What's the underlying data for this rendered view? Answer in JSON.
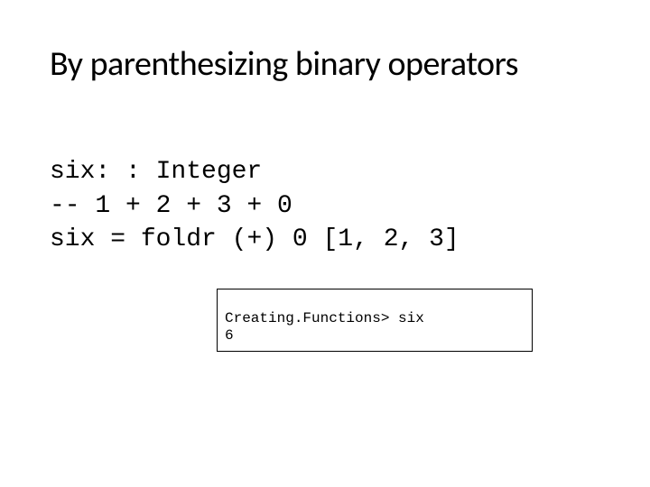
{
  "title": "By parenthesizing binary operators",
  "code": {
    "line1": "six: : Integer",
    "line2": "-- 1 + 2 + 3 + 0",
    "line3_prefix": "six = foldr ",
    "line3_op": "(+)",
    "line3_mid": " 0 ",
    "line3_list": "[1, 2, 3]"
  },
  "terminal": {
    "prompt_line": "Creating.Functions> six",
    "output_line": "6"
  }
}
